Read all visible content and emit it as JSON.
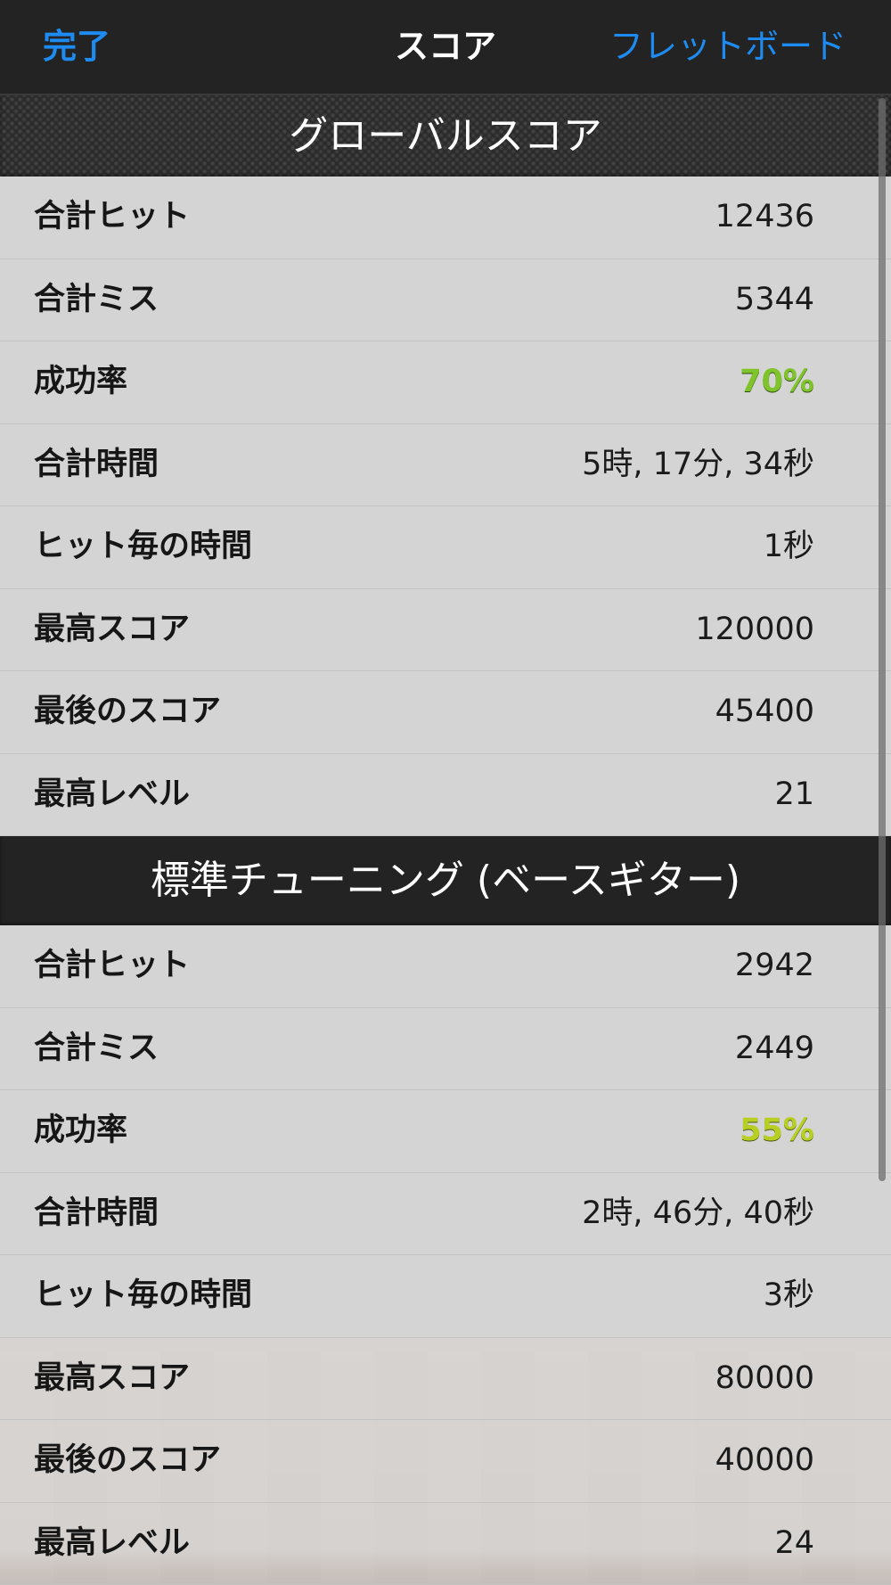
{
  "nav": {
    "done": "完了",
    "title": "スコア",
    "fretboard": "フレットボード"
  },
  "global": {
    "title": "グローバルスコア",
    "rows": [
      {
        "label": "合計ヒット",
        "value": "12436"
      },
      {
        "label": "合計ミス",
        "value": "5344"
      },
      {
        "label": "成功率",
        "value": "70%"
      },
      {
        "label": "合計時間",
        "value": "5時, 17分, 34秒"
      },
      {
        "label": "ヒット毎の時間",
        "value": "1秒"
      },
      {
        "label": "最高スコア",
        "value": "120000"
      },
      {
        "label": "最後のスコア",
        "value": "45400"
      },
      {
        "label": "最高レベル",
        "value": "21"
      }
    ]
  },
  "bass": {
    "title": "標準チューニング (ベースギター)",
    "rows": [
      {
        "label": "合計ヒット",
        "value": "2942"
      },
      {
        "label": "合計ミス",
        "value": "2449"
      },
      {
        "label": "成功率",
        "value": "55%"
      },
      {
        "label": "合計時間",
        "value": "2時, 46分, 40秒"
      },
      {
        "label": "ヒット毎の時間",
        "value": "3秒"
      },
      {
        "label": "最高スコア",
        "value": "80000"
      },
      {
        "label": "最後のスコア",
        "value": "40000"
      },
      {
        "label": "最高レベル",
        "value": "24"
      }
    ]
  },
  "colors": {
    "accent": "#1e8bf0",
    "rate_high": "#7ec42a",
    "rate_mid": "#b7cf22"
  }
}
